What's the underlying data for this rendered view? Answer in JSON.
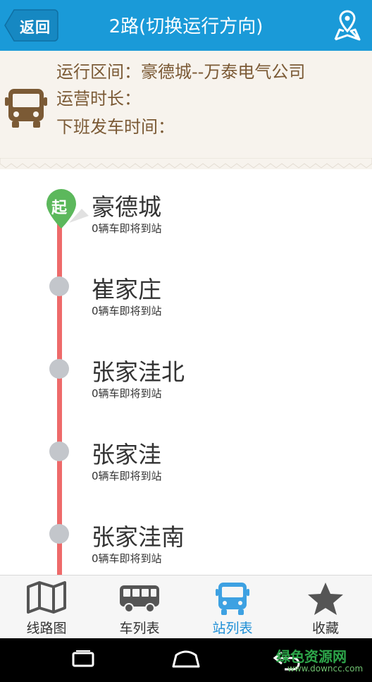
{
  "header": {
    "back_label": "返回",
    "title": "2路(切换运行方向)",
    "map_icon": "map-location-icon"
  },
  "info": {
    "bus_icon": "bus-icon",
    "range": "运行区间：豪德城--万泰电气公司",
    "duration": "运营时长：",
    "last_bus": "下班发车时间："
  },
  "stops": [
    {
      "name": "豪德城",
      "status": "0辆车即将到站",
      "badge": "起"
    },
    {
      "name": "崔家庄",
      "status": "0辆车即将到站"
    },
    {
      "name": "张家洼北",
      "status": "0辆车即将到站"
    },
    {
      "name": "张家洼",
      "status": "0辆车即将到站"
    },
    {
      "name": "张家洼南",
      "status": "0辆车即将到站"
    }
  ],
  "tabs": [
    {
      "label": "线路图",
      "icon": "map-icon",
      "active": false
    },
    {
      "label": "车列表",
      "icon": "bus-side-icon",
      "active": false
    },
    {
      "label": "站列表",
      "icon": "bus-front-icon",
      "active": true
    },
    {
      "label": "收藏",
      "icon": "star-icon",
      "active": false
    }
  ],
  "watermark": {
    "brand": "绿色资源网",
    "url": "www.downcc.com"
  },
  "colors": {
    "header": "#1a9ad8",
    "route_line": "#ee6a6a",
    "start_badge": "#5cb85c",
    "info_text": "#7b5a35",
    "active_tab": "#1e8fd6"
  }
}
